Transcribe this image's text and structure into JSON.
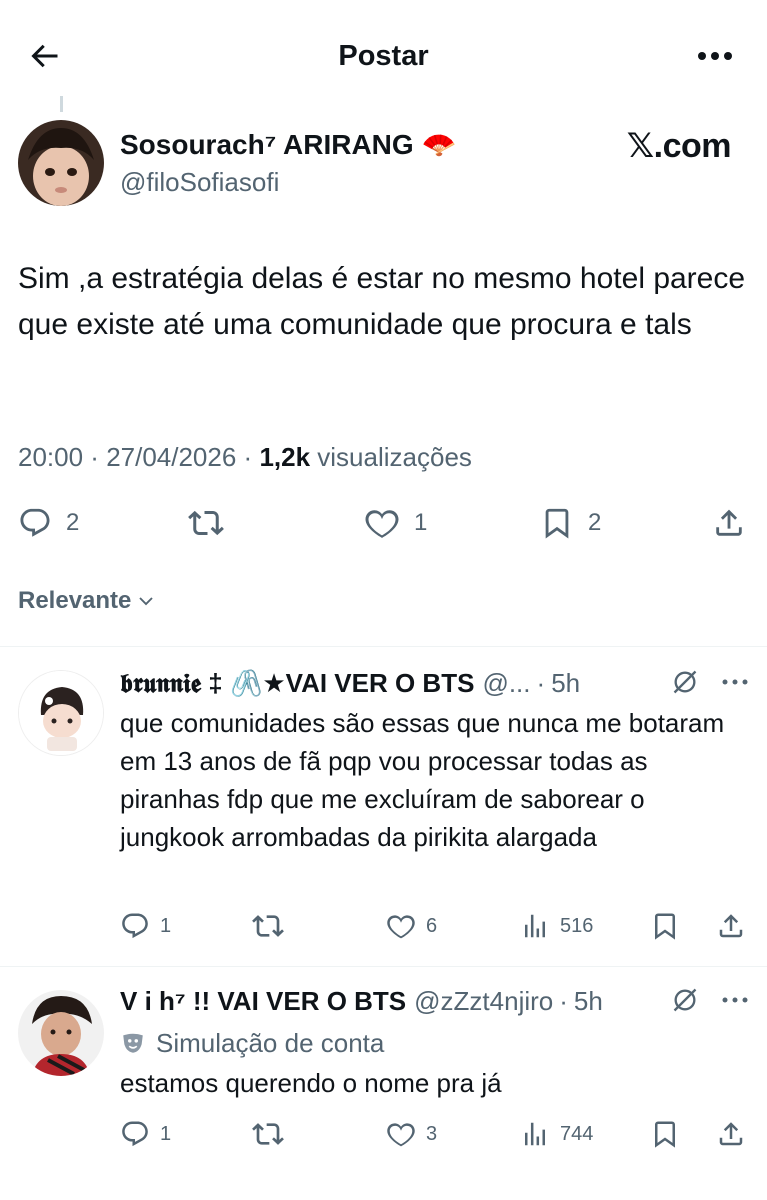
{
  "header": {
    "title": "Postar"
  },
  "post": {
    "author_name": "Sosourach⁷ ARIRANG 🪭",
    "author_handle": "@filoSofiasofi",
    "watermark": "𝕏.com",
    "text": "Sim ,a estratégia delas é estar no mesmo hotel parece que existe até uma comunidade que procura e tals",
    "time": "20:00",
    "date": "27/04/2026",
    "views_count": "1,2k",
    "views_label": "visualizações",
    "replies": "2",
    "reposts": "",
    "likes": "1",
    "bookmarks": "2"
  },
  "sort": {
    "label": "Relevante"
  },
  "replies": [
    {
      "name": "𝖇𝖗𝖚𝖓𝖓𝖎𝖊 ‡ 🖇️★VAI VER O BTS",
      "handle": "@...",
      "time": "5h",
      "text": "que comunidades são essas que nunca me botaram em 13 anos de fã pqp vou processar todas as piranhas fdp que me excluíram de saborear o jungkook arrombadas da pirikita alargada",
      "replies": "1",
      "reposts": "",
      "likes": "6",
      "views": "516"
    },
    {
      "name": "V i h⁷ !! VAI VER O BTS",
      "handle": "@zZzt4njiro",
      "time": "5h",
      "parody_label": "Simulação de conta",
      "text": "estamos querendo o nome pra já",
      "replies": "1",
      "reposts": "",
      "likes": "3",
      "views": "744"
    }
  ],
  "colors": {
    "text": "#0f1419",
    "secondary": "#536471",
    "divider": "#eff3f4"
  },
  "icons": [
    "back-arrow-icon",
    "more-icon",
    "reply-icon",
    "repost-icon",
    "like-icon",
    "bookmark-icon",
    "share-icon",
    "views-icon",
    "grok-icon",
    "chevron-down-icon",
    "parody-mask-icon"
  ]
}
